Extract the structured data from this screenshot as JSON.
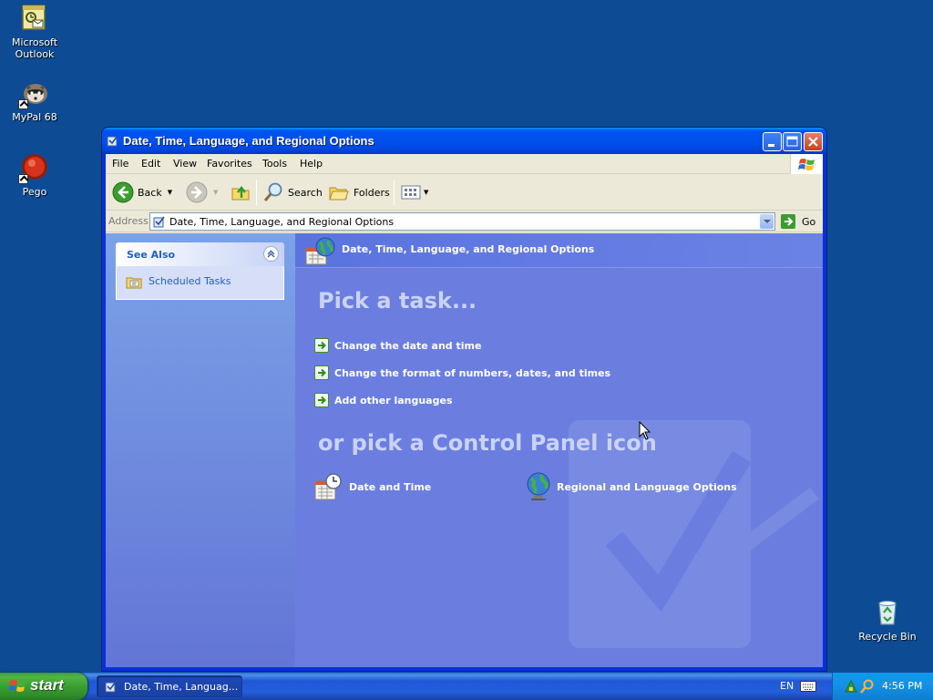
{
  "desktop": {
    "icons": [
      {
        "name": "outlook-desktop-icon",
        "label": "Microsoft Outlook"
      },
      {
        "name": "mypal-desktop-icon",
        "label": "MyPal 68"
      },
      {
        "name": "pego-desktop-icon",
        "label": "Pego"
      },
      {
        "name": "recycle-bin-desktop-icon",
        "label": "Recycle Bin"
      }
    ]
  },
  "window": {
    "title": "Date, Time, Language, and Regional Options",
    "menu": [
      "File",
      "Edit",
      "View",
      "Favorites",
      "Tools",
      "Help"
    ],
    "toolbar": {
      "back_label": "Back",
      "search_label": "Search",
      "folders_label": "Folders"
    },
    "address": {
      "label": "Address",
      "value": "Date, Time, Language, and Regional Options",
      "go_label": "Go"
    },
    "left_pane": {
      "see_also_title": "See Also",
      "links": [
        "Scheduled Tasks"
      ]
    },
    "content": {
      "header_title": "Date, Time, Language, and Regional Options",
      "pick_task_title": "Pick a task...",
      "tasks": [
        "Change the date and time",
        "Change the format of numbers, dates, and times",
        "Add other languages"
      ],
      "pick_icon_title": "or pick a Control Panel icon",
      "icons": [
        {
          "label": "Date and Time",
          "icon": "calendar-clock-icon"
        },
        {
          "label": "Regional and Language Options",
          "icon": "globe-icon"
        }
      ]
    }
  },
  "taskbar": {
    "start_label": "start",
    "task_item_label": "Date, Time, Languag...",
    "language": "EN",
    "clock": "4:56 PM"
  },
  "colors": {
    "desktop": "#0d4c94",
    "content_bg": "#6b7ee0",
    "link_blue": "#215dc6",
    "title_blue": "#0050ee"
  }
}
